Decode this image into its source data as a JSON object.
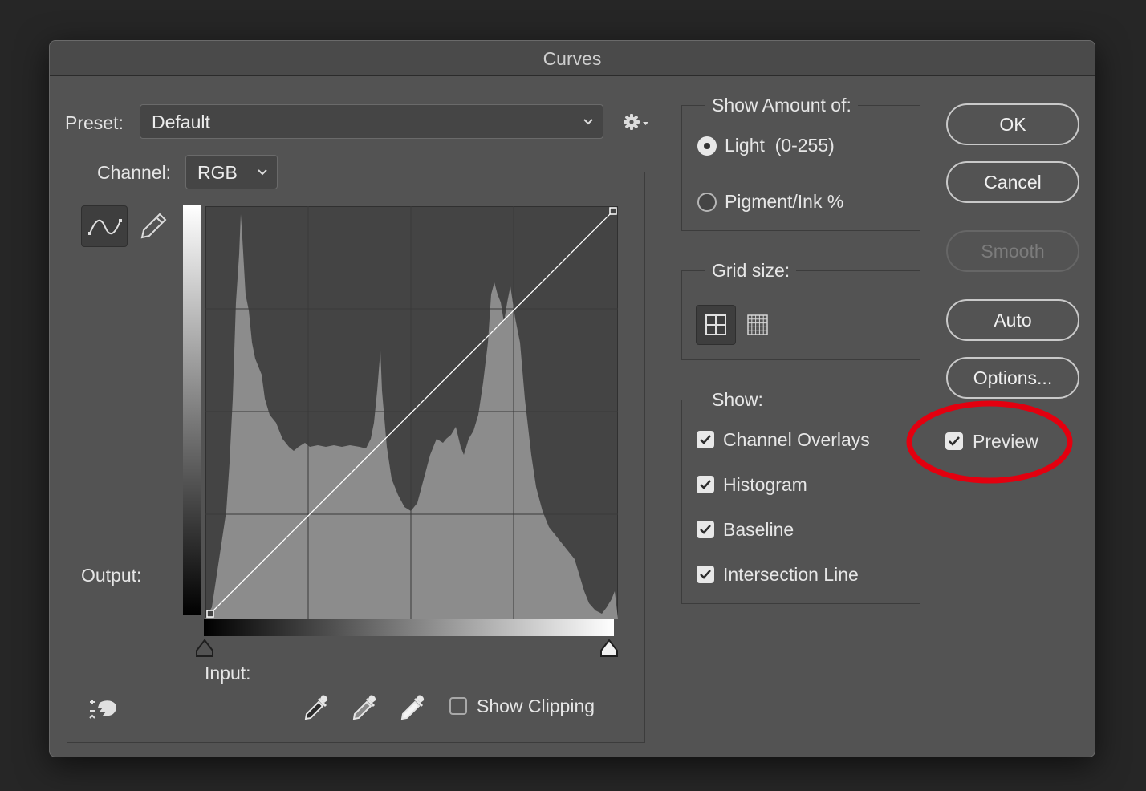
{
  "window": {
    "title": "Curves"
  },
  "preset": {
    "label": "Preset:",
    "value": "Default",
    "gear_icon": "gear-icon"
  },
  "channel": {
    "label": "Channel:",
    "value": "RGB"
  },
  "curve_tools": {
    "curve_icon": "curve-tool-icon",
    "pencil_icon": "pencil-icon"
  },
  "graph": {
    "output_label": "Output:",
    "input_label": "Input:",
    "histogram_color": "#8c8c8c",
    "grid_color": "#3a3a3a",
    "curve_color": "#ffffff"
  },
  "bottom_tools": {
    "targeted_adjust_icon": "hand-adjust-icon",
    "eyedroppers": [
      "black-point-eyedropper-icon",
      "gray-point-eyedropper-icon",
      "white-point-eyedropper-icon"
    ],
    "show_clipping": {
      "label": "Show Clipping",
      "checked": false
    }
  },
  "show_amount": {
    "title": "Show Amount of:",
    "options": [
      {
        "label": "Light  (0-255)",
        "selected": true
      },
      {
        "label": "Pigment/Ink %",
        "selected": false
      }
    ]
  },
  "grid_size": {
    "title": "Grid size:",
    "simple_icon": "grid-4x4-icon",
    "detailed_icon": "grid-10x10-icon",
    "selected": "simple"
  },
  "show": {
    "title": "Show:",
    "items": [
      {
        "label": "Channel Overlays",
        "checked": true
      },
      {
        "label": "Histogram",
        "checked": true
      },
      {
        "label": "Baseline",
        "checked": true
      },
      {
        "label": "Intersection Line",
        "checked": true
      }
    ]
  },
  "buttons": {
    "ok": "OK",
    "cancel": "Cancel",
    "smooth": "Smooth",
    "auto": "Auto",
    "options": "Options..."
  },
  "preview": {
    "label": "Preview",
    "checked": true
  },
  "annotation": {
    "color": "#e3000f"
  }
}
